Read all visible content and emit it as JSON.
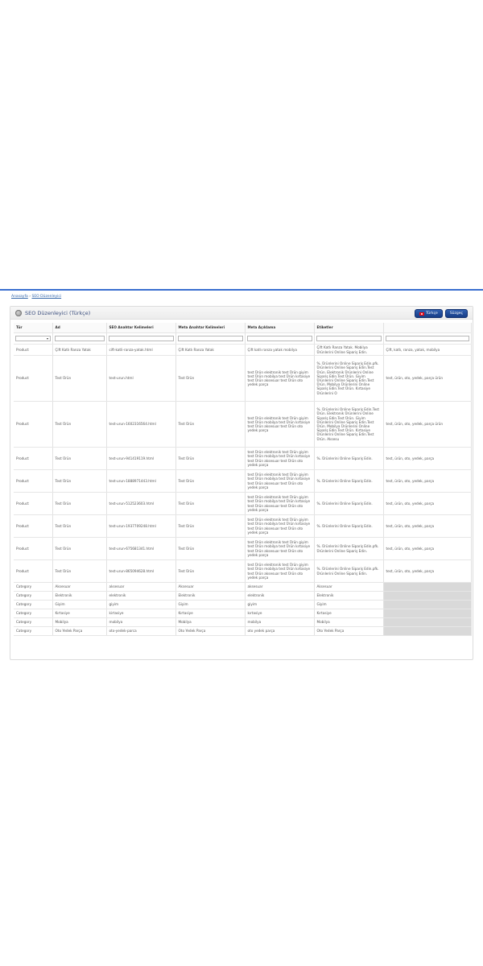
{
  "breadcrumb": {
    "home": "Anasayfa",
    "separator": " › ",
    "current": "SEO Düzenleyici"
  },
  "panel": {
    "title": "SEO Düzenleyici (Türkçe)",
    "language_button": "Türkçe",
    "filter_button": "Süzgeç"
  },
  "table": {
    "columns": [
      "Tür",
      "Ad",
      "SEO Anahtar Kelimeleri",
      "Meta Anahtar Kelimeleri",
      "Meta Açıklama",
      "Etiketler",
      ""
    ],
    "rows": [
      {
        "h": 14,
        "cells": [
          "Product",
          "Çift Katlı Ranza Yatak",
          "cift-katli-ranza-yatak.html",
          "Çift Katlı Ranza Yatak",
          "Çift katlı ranza yatak mobilya",
          "Çift Katlı Ranza Yatak. Mobilya Ürünlerini Online Sipariş Edin.",
          "Çift, katlı, ranza, yatak, mobilya"
        ]
      },
      {
        "h": 57,
        "cells": [
          "Product",
          "Test Ürün",
          "test-urun.html",
          "Test Ürün",
          "test Ürün elektronik test Ürün giyim test Ürün mobilya test Ürün kırtasiye test Ürün aksesuar test Ürün oto yedek parça",
          "%. Ürünlerini Online Sipariş Edin.pfk. Ürünlerini Online Sipariş Edin.Test Ürün. Elektronik Ürünlerini Online Sipariş Edin.Test Ürün. Giyim Ürünlerini Online Sipariş Edin.Test Ürün. Mobilya Ürünlerini Online Sipariş Edin.Test Ürün. Kırtasiye Ürünlerini O",
          "test, ürün, oto, yedek, parça ürün"
        ]
      },
      {
        "h": 57,
        "cells": [
          "Product",
          "Test Ürün",
          "test-urun-1602316564.html",
          "Test Ürün",
          "test Ürün elektronik test Ürün giyim test Ürün mobilya test Ürün kırtasiye test Ürün aksesuar test Ürün oto yedek parça",
          "%. Ürünlerini Online Sipariş Edin.Test Ürün. Elektronik Ürünlerini Online Sipariş Edin.Test Ürün. Giyim Ürünlerini Online Sipariş Edin.Test Ürün. Mobilya Ürünlerini Online Sipariş Edin.Test Ürün. Kırtasiye Ürünlerini Online Sipariş Edin.Test Ürün. Aksesu",
          "test, ürün, oto, yedek, parça ürün"
        ]
      },
      {
        "h": 28,
        "cells": [
          "Product",
          "Test Ürün",
          "test-urun-941419119.html",
          "Test Ürün",
          "test Ürün elektronik test Ürün giyim test Ürün mobilya test Ürün kırtasiye test Ürün aksesuar test Ürün oto yedek parça",
          "%. Ürünlerini Online Sipariş Edin.",
          "test, ürün, oto, yedek, parça"
        ]
      },
      {
        "h": 28,
        "cells": [
          "Product",
          "Test Ürün",
          "test-urun-1888971443.html",
          "Test Ürün",
          "test Ürün elektronik test Ürün giyim test Ürün mobilya test Ürün kırtasiye test Ürün aksesuar test Ürün oto yedek parça",
          "%. Ürünlerini Online Sipariş Edin.",
          "test, ürün, oto, yedek, parça"
        ]
      },
      {
        "h": 28,
        "cells": [
          "Product",
          "Test Ürün",
          "test-urun-512523603.html",
          "Test Ürün",
          "test Ürün elektronik test Ürün giyim test Ürün mobilya test Ürün kırtasiye test Ürün aksesuar test Ürün oto yedek parça",
          "%. Ürünlerini Online Sipariş Edin.",
          "test, ürün, oto, yedek, parça"
        ]
      },
      {
        "h": 28,
        "cells": [
          "Product",
          "Test Ürün",
          "test-urun-1937709248.html",
          "Test Ürün",
          "test Ürün elektronik test Ürün giyim test Ürün mobilya test Ürün kırtasiye test Ürün aksesuar test Ürün oto yedek parça",
          "%. Ürünlerini Online Sipariş Edin.",
          "test, ürün, oto, yedek, parça"
        ]
      },
      {
        "h": 28,
        "cells": [
          "Product",
          "Test Ürün",
          "test-urun-675681341.html",
          "Test Ürün",
          "test Ürün elektronik test Ürün giyim test Ürün mobilya test Ürün kırtasiye test Ürün aksesuar test Ürün oto yedek parça",
          "%. Ürünlerini Online Sipariş Edin.pfk. Ürünlerini Online Sipariş Edin.",
          "test, ürün, oto, yedek, parça"
        ]
      },
      {
        "h": 28,
        "cells": [
          "Product",
          "Test Ürün",
          "test-urun-865094628.html",
          "Test Ürün",
          "test Ürün elektronik test Ürün giyim test Ürün mobilya test Ürün kırtasiye test Ürün aksesuar test Ürün oto yedek parça",
          "%. Ürünlerini Online Sipariş Edin.pfk. Ürünlerini Online Sipariş Edin.",
          "test, ürün, oto, yedek, parça"
        ]
      },
      {
        "h": 11,
        "cells": [
          "Category",
          "Aksesuar",
          "aksesuar",
          "Aksesuar",
          "aksesuar",
          "Aksesuar",
          ""
        ]
      },
      {
        "h": 11,
        "cells": [
          "Category",
          "Elektronik",
          "elektronik",
          "Elektronik",
          "elektronik",
          "Elektronik",
          ""
        ]
      },
      {
        "h": 11,
        "cells": [
          "Category",
          "Giyim",
          "giyim",
          "Giyim",
          "giyim",
          "Giyim",
          ""
        ]
      },
      {
        "h": 11,
        "cells": [
          "Category",
          "Kırtasiye",
          "kirtasiye",
          "Kırtasiye",
          "kırtasiye",
          "Kırtasiye",
          ""
        ]
      },
      {
        "h": 11,
        "cells": [
          "Category",
          "Mobilya",
          "mobilya",
          "Mobilya",
          "mobilya",
          "Mobilya",
          ""
        ]
      },
      {
        "h": 11,
        "cells": [
          "Category",
          "Oto Yedek Parça",
          "oto-yedek-parca",
          "Oto Yedek Parça",
          "oto yedek parça",
          "Oto Yedek Parça",
          ""
        ]
      }
    ]
  }
}
